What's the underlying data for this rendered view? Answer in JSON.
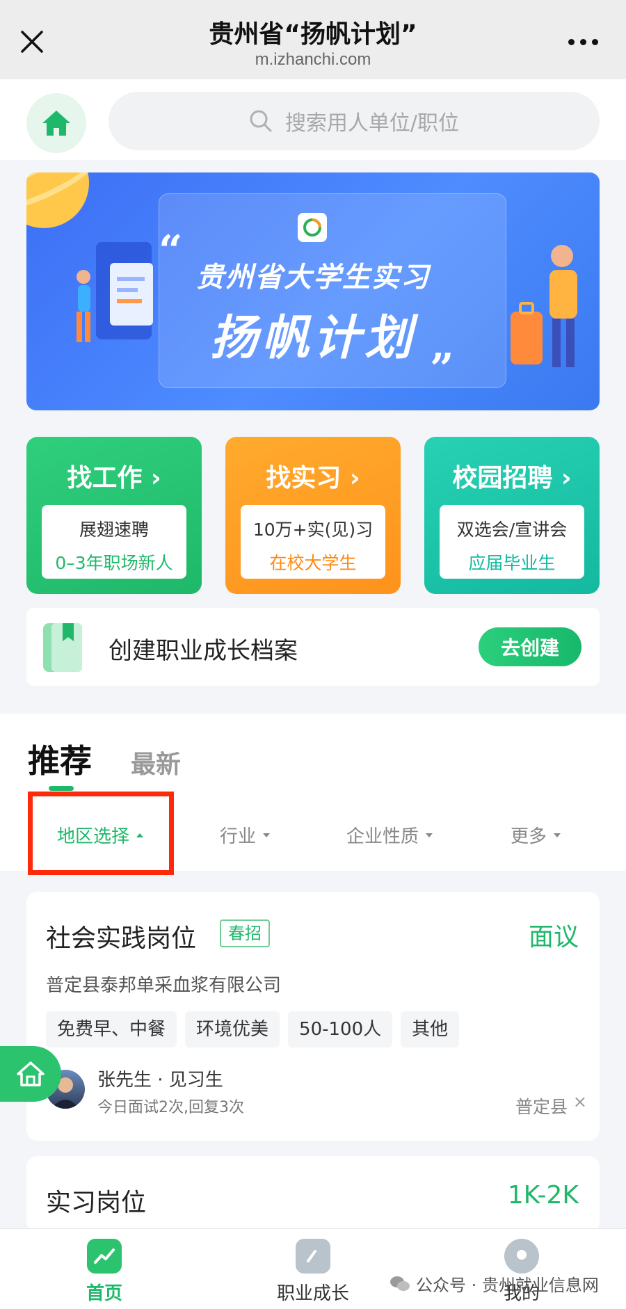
{
  "titlebar": {
    "title": "贵州省“扬帆计划”",
    "url": "m.izhanchi.com"
  },
  "search": {
    "placeholder": "搜索用人单位/职位"
  },
  "banner": {
    "line1": "贵州省大学生实习",
    "line2": "扬帆计划",
    "quote_open": "“",
    "quote_close": "”"
  },
  "tiles": [
    {
      "title": "找工作 ›",
      "sub1": "展翅速聘",
      "sub2": "0–3年职场新人"
    },
    {
      "title": "找实习 ›",
      "sub1": "10万+实(见)习",
      "sub2": "在校大学生"
    },
    {
      "title": "校园招聘 ›",
      "sub1": "双选会/宣讲会",
      "sub2": "应届毕业生"
    }
  ],
  "profile": {
    "text": "创建职业成长档案",
    "button": "去创建"
  },
  "feed": {
    "tabs": [
      "推荐",
      "最新"
    ],
    "filters": [
      "地区选择",
      "行业",
      "企业性质",
      "更多"
    ]
  },
  "jobs": [
    {
      "title": "社会实践岗位",
      "tag": "春招",
      "salary": "面议",
      "company": "普定县泰邦单采血浆有限公司",
      "tags": [
        "免费早、中餐",
        "环境优美",
        "50-100人",
        "其他"
      ],
      "recruiter": "张先生 · 见习生",
      "stats": "今日面试2次,回复3次",
      "location": "普定县",
      "close": "×"
    },
    {
      "title": "实习岗位",
      "salary": "1K-2K"
    }
  ],
  "nav": {
    "home": "首页",
    "growth": "职业成长",
    "mine": "我的"
  },
  "watermark": "公众号 · 贵州就业信息网",
  "colors": {
    "accent": "#1fb86a",
    "orange": "#ff921c",
    "teal": "#14b9a0",
    "highlight": "#ff2a0a"
  }
}
